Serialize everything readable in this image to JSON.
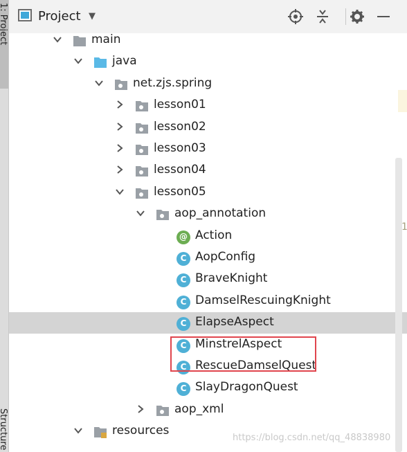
{
  "strip": {
    "project_tab": "1: Project",
    "structure_tab": "Structure"
  },
  "header": {
    "title": "Project"
  },
  "tree": {
    "rows": [
      {
        "label": "main",
        "kind": "folder-gray",
        "expanded": true
      },
      {
        "label": "java",
        "kind": "folder-blue",
        "expanded": true
      },
      {
        "label": "net.zjs.spring",
        "kind": "package",
        "expanded": true
      },
      {
        "label": "lesson01",
        "kind": "package",
        "expanded": false
      },
      {
        "label": "lesson02",
        "kind": "package",
        "expanded": false
      },
      {
        "label": "lesson03",
        "kind": "package",
        "expanded": false
      },
      {
        "label": "lesson04",
        "kind": "package",
        "expanded": false
      },
      {
        "label": "lesson05",
        "kind": "package",
        "expanded": true
      },
      {
        "label": "aop_annotation",
        "kind": "package",
        "expanded": true
      },
      {
        "label": "Action",
        "kind": "annotation",
        "icon_letter": "@"
      },
      {
        "label": "AopConfig",
        "kind": "class",
        "icon_letter": "C"
      },
      {
        "label": "BraveKnight",
        "kind": "class",
        "icon_letter": "C"
      },
      {
        "label": "DamselRescuingKnight",
        "kind": "class",
        "icon_letter": "C"
      },
      {
        "label": "ElapseAspect",
        "kind": "class",
        "icon_letter": "C",
        "selected": true
      },
      {
        "label": "MinstrelAspect",
        "kind": "class",
        "icon_letter": "C"
      },
      {
        "label": "RescueDamselQuest",
        "kind": "class",
        "icon_letter": "C"
      },
      {
        "label": "SlayDragonQuest",
        "kind": "class",
        "icon_letter": "C"
      },
      {
        "label": "aop_xml",
        "kind": "package",
        "expanded": false
      },
      {
        "label": "resources",
        "kind": "resources-folder",
        "expanded": true
      }
    ]
  },
  "editor_gutter_digit": "1",
  "watermark": "https://blog.csdn.net/qq_48838980",
  "colors": {
    "selection": "#d4d4d4",
    "highlight_box": "#e0454d",
    "class_icon": "#4fb0d6",
    "annotation_icon": "#6cad52"
  }
}
